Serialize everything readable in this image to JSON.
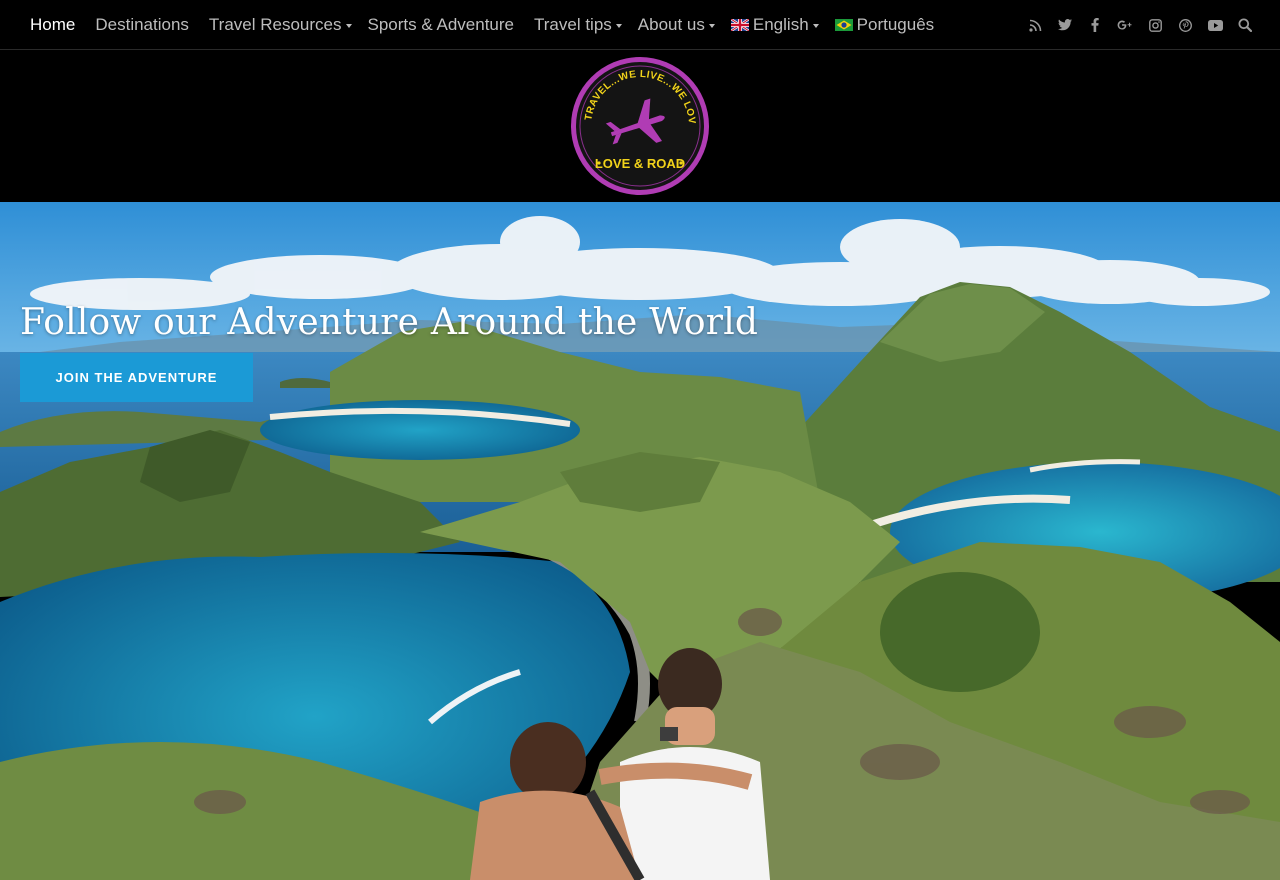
{
  "nav": {
    "items": [
      {
        "label": "Home",
        "active": true,
        "has_submenu": false
      },
      {
        "label": "Destinations",
        "active": false,
        "has_submenu": false
      },
      {
        "label": "Travel Resources",
        "active": false,
        "has_submenu": true
      },
      {
        "label": "Sports & Adventure",
        "active": false,
        "has_submenu": false
      },
      {
        "label": "Travel tips",
        "active": false,
        "has_submenu": true
      },
      {
        "label": "About us",
        "active": false,
        "has_submenu": true
      }
    ],
    "languages": [
      {
        "label": "English",
        "flag": "uk-flag-icon",
        "has_submenu": true
      },
      {
        "label": "Português",
        "flag": "brazil-flag-icon",
        "has_submenu": false
      }
    ],
    "social_icons": [
      "rss-icon",
      "twitter-icon",
      "facebook-icon",
      "google-plus-icon",
      "instagram-icon",
      "pinterest-icon",
      "youtube-icon",
      "search-icon"
    ]
  },
  "logo": {
    "arc_text": "WE TRAVEL...WE LIVE...WE LOVE...",
    "name": "LOVE & ROAD"
  },
  "hero": {
    "title": "Follow our Adventure Around the World",
    "cta_label": "JOIN THE ADVENTURE"
  },
  "colors": {
    "background": "#000000",
    "nav_text": "#bdbdbd",
    "nav_active": "#ffffff",
    "cta": "#1b9ad6",
    "logo_ring": "#b03cb4",
    "logo_yellow": "#f2d31a"
  }
}
